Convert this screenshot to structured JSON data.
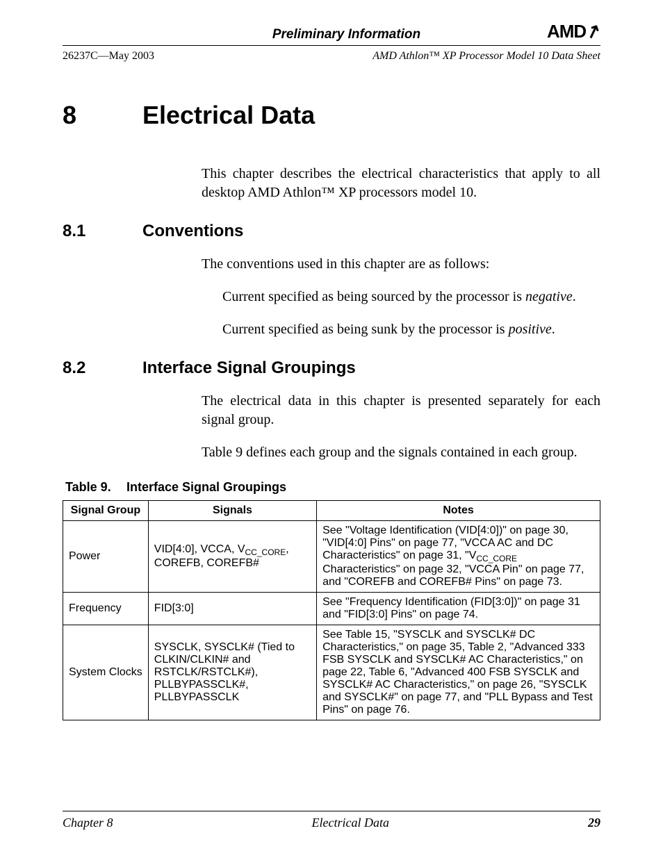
{
  "header": {
    "preliminary": "Preliminary Information",
    "logo_text": "AMD",
    "doc_id": "26237C—May 2003",
    "doc_title": "AMD Athlon™ XP Processor Model 10 Data Sheet"
  },
  "chapter": {
    "number": "8",
    "title": "Electrical Data",
    "intro": "This chapter describes the electrical characteristics that apply to all desktop AMD Athlon™  XP processors model 10."
  },
  "sections": {
    "s1": {
      "number": "8.1",
      "title": "Conventions",
      "intro": "The conventions used in this chapter are as follows:",
      "item1_a": "Current specified as being sourced by the processor is ",
      "item1_b": "negative",
      "item1_c": ".",
      "item2_a": "Current specified as being sunk by the processor is ",
      "item2_b": "positive",
      "item2_c": "."
    },
    "s2": {
      "number": "8.2",
      "title": "Interface Signal Groupings",
      "p1": "The electrical data in this chapter is presented separately for each signal group.",
      "p2": "Table 9 defines each group and the signals contained in each group."
    }
  },
  "table": {
    "caption_label": "Table 9.",
    "caption_title": "Interface Signal Groupings",
    "headers": {
      "c1": "Signal Group",
      "c2": "Signals",
      "c3": "Notes"
    },
    "rows": {
      "r1": {
        "group": "Power",
        "sig_a": "VID[4:0], VCCA, V",
        "sig_sub": "CC_CORE",
        "sig_b": ", COREFB, COREFB#",
        "notes_a": "See \"Voltage Identification (VID[4:0])\" on page 30, \"VID[4:0] Pins\" on page 77, \"VCCA AC and DC Characteristics\" on page 31, \"V",
        "notes_sub": "CC_CORE",
        "notes_b": " Characteristics\" on page 32, \"VCCA Pin\" on page 77, and \"COREFB and COREFB# Pins\" on page 73."
      },
      "r2": {
        "group": "Frequency",
        "signals": "FID[3:0]",
        "notes": "See \"Frequency Identification (FID[3:0])\" on page 31 and \"FID[3:0] Pins\" on page 74."
      },
      "r3": {
        "group": "System Clocks",
        "signals": "SYSCLK, SYSCLK# (Tied to CLKIN/CLKIN# and RSTCLK/RSTCLK#), PLLBYPASSCLK#, PLLBYPASSCLK",
        "notes": "See Table 15, \"SYSCLK and SYSCLK# DC Characteristics,\" on page 35, Table 2, \"Advanced 333 FSB SYSCLK and SYSCLK# AC Characteristics,\" on page 22, Table 6, \"Advanced 400 FSB SYSCLK and SYSCLK# AC Characteristics,\" on page 26, \"SYSCLK and SYSCLK#\" on page 77, and \"PLL Bypass and Test Pins\" on page 76."
      }
    }
  },
  "footer": {
    "left": "Chapter 8",
    "center": "Electrical Data",
    "page": "29"
  }
}
